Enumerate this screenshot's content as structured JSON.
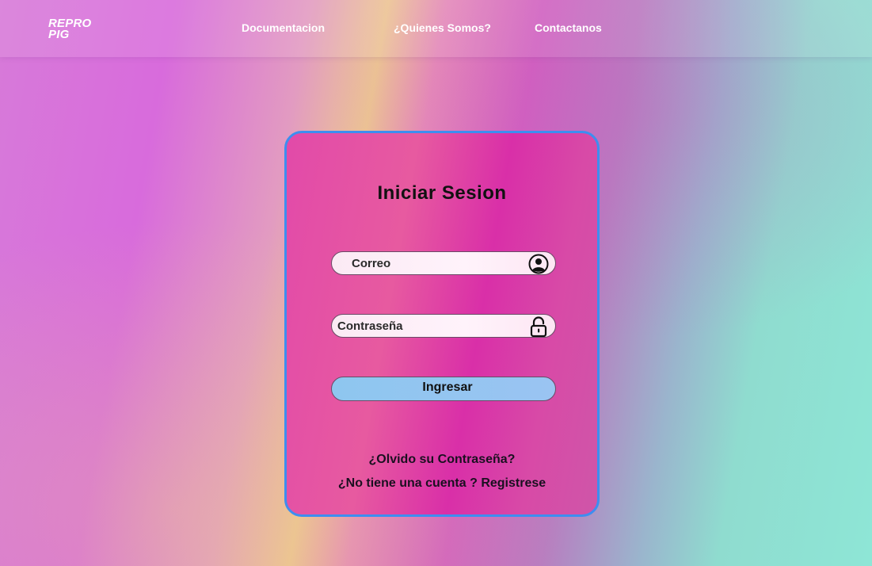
{
  "brand": {
    "logo_line1": "REPRO",
    "logo_line2": "PIG"
  },
  "nav": {
    "items": [
      {
        "label": "Documentacion"
      },
      {
        "label": "¿Quienes Somos?"
      },
      {
        "label": "Contactanos"
      }
    ]
  },
  "login": {
    "title": "Iniciar  Sesion",
    "email_placeholder": "Correo",
    "password_placeholder": "Contraseña",
    "email_icon": "user-circle-icon",
    "password_icon": "unlock-icon",
    "submit_label": "Ingresar",
    "forgot_label": "¿Olvido su Contraseña?",
    "register_label": "¿No tiene una cuenta ? Registrese"
  },
  "colors": {
    "card_border": "#3d8ef0",
    "card_fill": "#e24aa9",
    "button_fill": "#9ac4f2",
    "nav_text": "#ffffff",
    "background_left": "#d86bdc",
    "background_right": "#8ee6d6"
  }
}
